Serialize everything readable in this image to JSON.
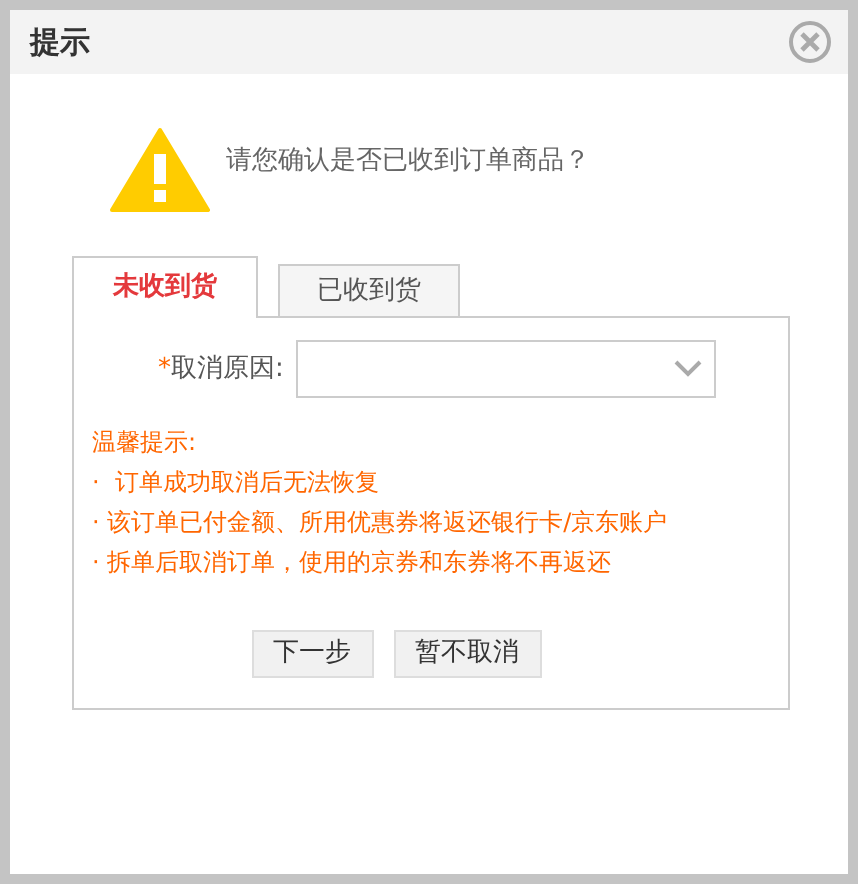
{
  "dialog": {
    "title": "提示",
    "message": "请您确认是否已收到订单商品？"
  },
  "tabs": [
    {
      "label": "未收到货",
      "selected": true
    },
    {
      "label": "已收到货",
      "selected": false
    }
  ],
  "form": {
    "required_mark": "*",
    "label": "取消原因:"
  },
  "tips": {
    "heading": "温馨提示:",
    "items": [
      "·  订单成功取消后无法恢复",
      "· 该订单已付金额、所用优惠券将返还银行卡/京东账户",
      "· 拆单后取消订单，使用的京券和东券将不再返还"
    ]
  },
  "buttons": [
    "下一步",
    "暂不取消"
  ]
}
